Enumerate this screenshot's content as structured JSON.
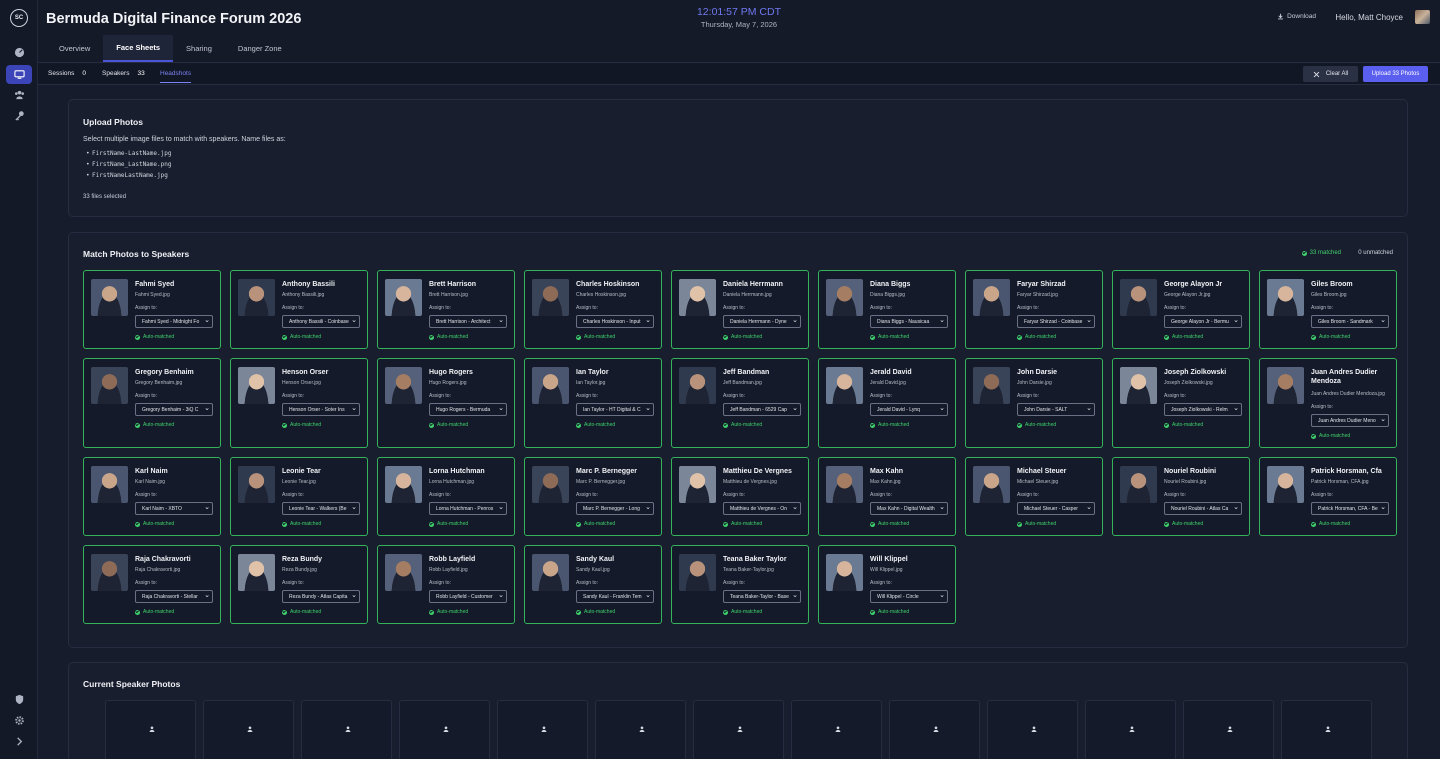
{
  "app": {
    "logo_text": "SC",
    "title": "Bermuda Digital Finance Forum 2026"
  },
  "header": {
    "clock": "12:01:57 PM CDT",
    "date": "Thursday, May 7, 2026",
    "download_label": "Download",
    "greeting": "Hello, Matt Choyce",
    "tabs": [
      "Overview",
      "Face Sheets",
      "Sharing",
      "Danger Zone"
    ],
    "active_tab": "Face Sheets"
  },
  "subnav": {
    "sessions_label": "Sessions",
    "sessions_count": "0",
    "speakers_label": "Speakers",
    "speakers_count": "33",
    "headshots_label": "Headshots",
    "clear_all_label": "Clear All",
    "upload_label": "Upload 33 Photos"
  },
  "upload_panel": {
    "title": "Upload Photos",
    "description": "Select multiple image files to match with speakers. Name files as:",
    "formats": [
      "FirstName-LastName.jpg",
      "FirstName_LastName.png",
      "FirstNameLastName.jpg"
    ],
    "selected": "33 files selected"
  },
  "match_panel": {
    "title": "Match Photos to Speakers",
    "matched": "33 matched",
    "unmatched": "0 unmatched",
    "assign_label": "Assign to:",
    "status_label": "Auto-matched",
    "cards": [
      {
        "name": "Fahmi Syed",
        "file": "Fahmi Syed.jpg",
        "assign": "Fahmi Syed - Midnight Fo"
      },
      {
        "name": "Anthony Bassili",
        "file": "Anthony Bassili.jpg",
        "assign": "Anthony Bassili - Coinbase"
      },
      {
        "name": "Brett Harrison",
        "file": "Brett Harrison.jpg",
        "assign": "Brett Harrison - Architect"
      },
      {
        "name": "Charles Hoskinson",
        "file": "Charles Hoskinson.jpg",
        "assign": "Charles Hoskinson - Input"
      },
      {
        "name": "Daniela Herrmann",
        "file": "Daniela Herrmann.jpg",
        "assign": "Daniela Herrmann - Dyne"
      },
      {
        "name": "Diana Biggs",
        "file": "Diana Biggs.jpg",
        "assign": "Diana Biggs - Nausicaa"
      },
      {
        "name": "Faryar Shirzad",
        "file": "Faryar Shirzad.jpg",
        "assign": "Faryar Shirzad - Coinbase"
      },
      {
        "name": "George Alayon Jr",
        "file": "George Alayon Jr.jpg",
        "assign": "George Alayon Jr - Bermu"
      },
      {
        "name": "Giles Broom",
        "file": "Giles Broom.jpg",
        "assign": "Giles Broom - Sandmark"
      },
      {
        "name": "Gregory Benhaim",
        "file": "Gregory Benhaim.jpg",
        "assign": "Gregory Benhaim - 3iQ C"
      },
      {
        "name": "Henson Orser",
        "file": "Henson Orser.jpg",
        "assign": "Henson Orser - Soter Ins"
      },
      {
        "name": "Hugo Rogers",
        "file": "Hugo Rogers.jpg",
        "assign": "Hugo Rogers - Bermuda"
      },
      {
        "name": "Ian Taylor",
        "file": "Ian Taylor.jpg",
        "assign": "Ian Taylor - HT Digital & C"
      },
      {
        "name": "Jeff Bandman",
        "file": "Jeff Bandman.jpg",
        "assign": "Jeff Bandman - 6529 Cap"
      },
      {
        "name": "Jerald David",
        "file": "Jerald David.jpg",
        "assign": "Jerald David - Lynq"
      },
      {
        "name": "John Darsie",
        "file": "John Darsie.jpg",
        "assign": "John Darsie - SALT"
      },
      {
        "name": "Joseph Ziolkowski",
        "file": "Joseph Ziolkowski.jpg",
        "assign": "Joseph Ziolkowski - Relm"
      },
      {
        "name": "Juan Andres Dudier Mendoza",
        "file": "Juan Andres Dudier Mendoza.jpg",
        "assign": "Juan Andres Dudier Meno"
      },
      {
        "name": "Karl Naim",
        "file": "Karl Naim.jpg",
        "assign": "Karl Naim - XBTO"
      },
      {
        "name": "Leonie Tear",
        "file": "Leonie Tear.jpg",
        "assign": "Leonie Tear - Walkers (Be"
      },
      {
        "name": "Lorna Hutchman",
        "file": "Lorna Hutchman.jpg",
        "assign": "Lorna Hutchman - Penros"
      },
      {
        "name": "Marc P. Bernegger",
        "file": "Marc P. Bernegger.jpg",
        "assign": "Marc P. Bernegger - Long"
      },
      {
        "name": "Matthieu De Vergnes",
        "file": "Matthieu de Vergnes.jpg",
        "assign": "Matthieu de Vergnes - On"
      },
      {
        "name": "Max Kahn",
        "file": "Max Kahn.jpg",
        "assign": "Max Kahn - Digital Wealth"
      },
      {
        "name": "Michael Steuer",
        "file": "Michael Steuer.jpg",
        "assign": "Michael Steuer - Casper"
      },
      {
        "name": "Nouriel Roubini",
        "file": "Nouriel Roubini.jpg",
        "assign": "Nouriel Roubini - Atlas Ca"
      },
      {
        "name": "Patrick Horsman, Cfa",
        "file": "Patrick Horsman, CFA.jpg",
        "assign": "Patrick Horsman, CFA - Be"
      },
      {
        "name": "Raja Chakravorti",
        "file": "Raja Chakravorti.jpg",
        "assign": "Raja Chakravorti - Stellar"
      },
      {
        "name": "Reza Bundy",
        "file": "Reza Bundy.jpg",
        "assign": "Reza Bundy - Atlas Capita"
      },
      {
        "name": "Robb Layfield",
        "file": "Robb Layfield.jpg",
        "assign": "Robb Layfield - Customer"
      },
      {
        "name": "Sandy Kaul",
        "file": "Sandy Kaul.jpg",
        "assign": "Sandy Kaul - Franklin Tem"
      },
      {
        "name": "Teana Baker Taylor",
        "file": "Teana Baker-Taylor.jpg",
        "assign": "Teana Baker-Taylor - Base"
      },
      {
        "name": "Will Klippel",
        "file": "Will Klippel.jpg",
        "assign": "Will Klippel - Circle"
      }
    ]
  },
  "current_panel": {
    "title": "Current Speaker Photos",
    "slot_icon": "person-icon"
  },
  "colors": {
    "accent": "#5a5ff0",
    "matched_green": "#3fd26b",
    "card_border": "#35b35a",
    "background": "#171c2c"
  }
}
